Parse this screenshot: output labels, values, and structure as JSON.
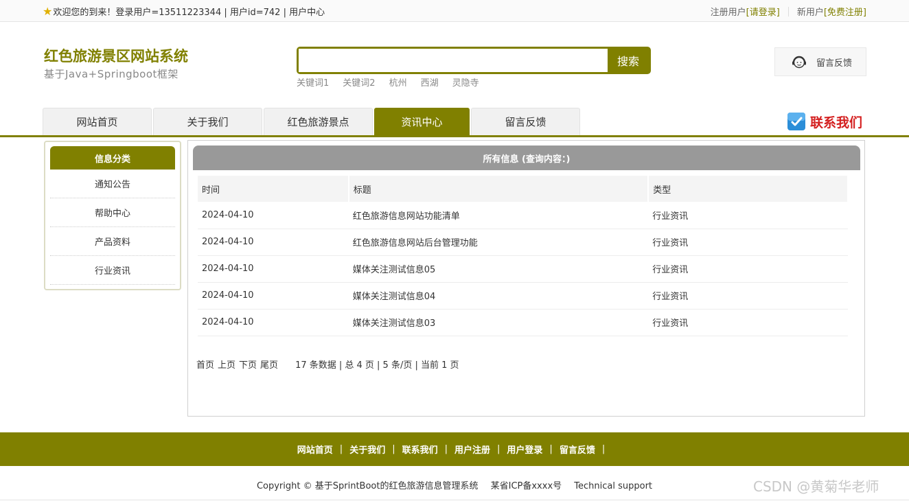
{
  "topbar": {
    "welcome": "欢迎您的到来！登录用户=13511223344 | 用户id=742 | 用户中心",
    "register_label": "注册用户",
    "login_link": "[请登录]",
    "new_user_label": "新用户",
    "free_register_link": "[免费注册]"
  },
  "header": {
    "title": "红色旅游景区网站系统",
    "subtitle": "基于Java+Springboot框架",
    "search": {
      "value": "",
      "placeholder": "",
      "button": "搜索"
    },
    "keywords": [
      "关键词1",
      "关键词2",
      "杭州",
      "西湖",
      "灵隐寺"
    ],
    "feedback_label": "留言反馈"
  },
  "nav": {
    "tabs": [
      "网站首页",
      "关于我们",
      "红色旅游景点",
      "资讯中心",
      "留言反馈"
    ],
    "active": "资讯中心",
    "contact": "联系我们"
  },
  "sidebar": {
    "title": "信息分类",
    "items": [
      "通知公告",
      "帮助中心",
      "产品资料",
      "行业资讯"
    ]
  },
  "main": {
    "title": "所有信息 (查询内容：)",
    "columns": [
      "时间",
      "标题",
      "类型"
    ],
    "rows": [
      [
        "2024-04-10",
        "红色旅游信息网站功能清单",
        "行业资讯"
      ],
      [
        "2024-04-10",
        "红色旅游信息网站后台管理功能",
        "行业资讯"
      ],
      [
        "2024-04-10",
        "媒体关注测试信息05",
        "行业资讯"
      ],
      [
        "2024-04-10",
        "媒体关注测试信息04",
        "行业资讯"
      ],
      [
        "2024-04-10",
        "媒体关注测试信息03",
        "行业资讯"
      ]
    ],
    "pager": {
      "first": "首页",
      "prev": "上页",
      "next": "下页",
      "last": "尾页",
      "info": "17 条数据 | 总 4 页 | 5 条/页 | 当前 1 页"
    }
  },
  "footer": {
    "links": [
      "网站首页",
      "关于我们",
      "联系我们",
      "用户注册",
      "用户登录",
      "留言反馈"
    ],
    "copyright": "Copyright © 基于SprintBoot的红色旅游信息管理系统",
    "icp": "某省ICP备xxxx号",
    "support": "Technical support"
  },
  "watermark": "CSDN @黄菊华老师",
  "colors": {
    "accent": "#808000",
    "contact_red": "#d42020",
    "panel_head": "#999999"
  }
}
